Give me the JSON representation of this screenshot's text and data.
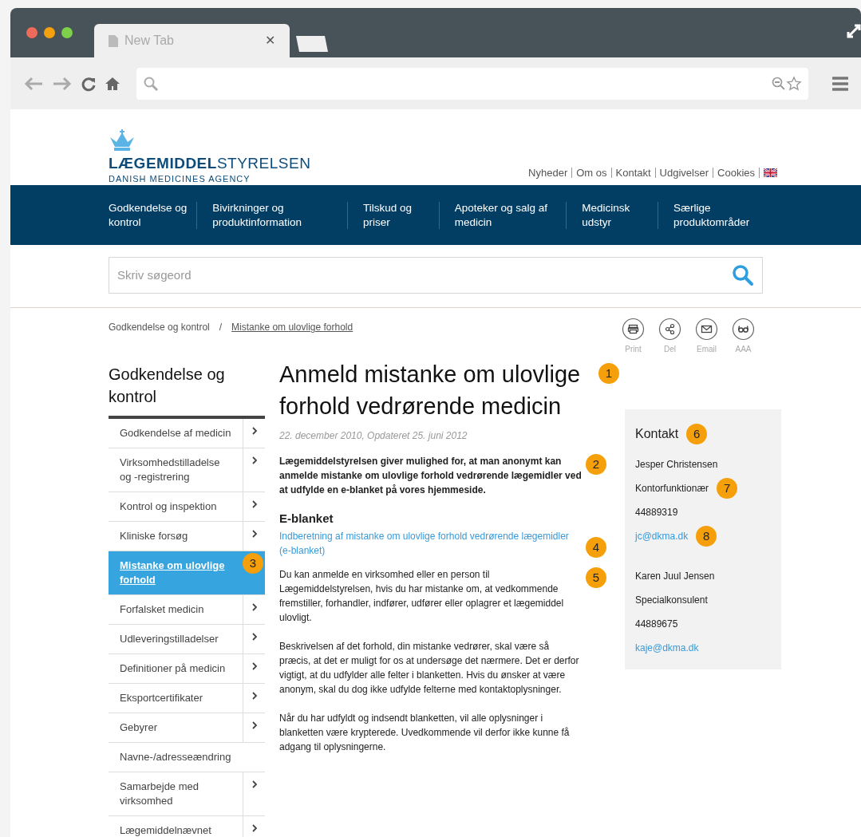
{
  "browser": {
    "tab": {
      "title": "New Tab",
      "close": "✕"
    }
  },
  "site": {
    "logo": {
      "name": "LÆGEMIDDEL",
      "name2": "STYRELSEN",
      "subtitle": "DANISH MEDICINES AGENCY"
    },
    "top_links": [
      "Nyheder",
      "Om os",
      "Kontakt",
      "Udgivelser",
      "Cookies"
    ],
    "nav": [
      "Godkendelse og kontrol",
      "Bivirkninger og produktinformation",
      "Tilskud og priser",
      "Apoteker og salg af medicin",
      "Medicinsk udstyr",
      "Særlige produktområder"
    ],
    "search": {
      "placeholder": "Skriv søgeord"
    },
    "breadcrumb": [
      {
        "label": "Godkendelse og kontrol",
        "current": false
      },
      {
        "label": "Mistanke om ulovlige forhold",
        "current": true
      }
    ],
    "separator": "/",
    "tools": [
      {
        "kind": "print",
        "label": "Print"
      },
      {
        "kind": "share",
        "label": "Del"
      },
      {
        "kind": "email",
        "label": "Email"
      },
      {
        "kind": "glasses",
        "label": "AAA"
      }
    ]
  },
  "sidebar": {
    "title": "Godkendelse og kontrol",
    "items": [
      {
        "label": "Godkendelse af medicin",
        "selected": false,
        "expandable": true
      },
      {
        "label": "Virksomhedstilladelse og -registrering",
        "selected": false,
        "expandable": true
      },
      {
        "label": "Kontrol og inspektion",
        "selected": false,
        "expandable": true
      },
      {
        "label": "Kliniske forsøg",
        "selected": false,
        "expandable": true
      },
      {
        "label": "Mistanke om ulovlige forhold",
        "selected": true,
        "expandable": false,
        "badge": "3"
      },
      {
        "label": "Forfalsket medicin",
        "selected": false,
        "expandable": true
      },
      {
        "label": "Udleveringstilladelser",
        "selected": false,
        "expandable": true
      },
      {
        "label": "Definitioner på medicin",
        "selected": false,
        "expandable": true
      },
      {
        "label": "Eksportcertifikater",
        "selected": false,
        "expandable": true
      },
      {
        "label": "Gebyrer",
        "selected": false,
        "expandable": true
      },
      {
        "label": "Navne-/adresseændring",
        "selected": false,
        "expandable": false
      },
      {
        "label": "Samarbejde med virksomhed",
        "selected": false,
        "expandable": true
      },
      {
        "label": "Lægemiddelnævnet",
        "selected": false,
        "expandable": true
      }
    ]
  },
  "article": {
    "title": "Anmeld mistanke om ulovlige forhold vedrørende medicin",
    "title_badge": "1",
    "date": "22. december 2010, Opdateret 25. juni 2012",
    "intro": "Lægemiddelstyrelsen giver mulighed for, at man anonymt kan anmelde mistanke om ulovlige forhold vedrørende lægemidler ved at udfylde en e-blanket på vores hjemmeside.",
    "intro_badge": "2",
    "subheading": "E-blanket",
    "link": "Indberetning af mistanke om ulovlige forhold vedrørende lægemidler (e-blanket)",
    "link_badge": "4",
    "paragraphs": [
      "Du kan anmelde en virksomhed eller en person til Lægemiddelstyrelsen, hvis du har mistanke om, at vedkommende fremstiller, forhandler, indfører, udfører eller oplagrer et lægemiddel ulovligt.",
      "Beskrivelsen af det forhold, din mistanke vedrører, skal være så præcis, at det er muligt for os at undersøge det nærmere. Det er derfor vigtigt, at du udfylder alle felter i blanketten. Hvis du ønsker at være anonym, skal du dog ikke udfylde felterne med kontaktoplysninger.",
      "Når du har udfyldt og indsendt blanketten, vil alle oplysninger i blanketten være krypterede. Uvedkommende vil derfor ikke kunne få adgang til oplysningerne."
    ],
    "paragraph_badge": "5"
  },
  "contact": {
    "title": "Kontakt",
    "title_badge": "6",
    "people": [
      {
        "name": "Jesper Christensen",
        "role": "Kontorfunktionær",
        "phone": "44889319",
        "email": "jc@dkma.dk",
        "role_badge": "7",
        "email_badge": "8"
      },
      {
        "name": "Karen Juul Jensen",
        "role": "Specialkonsulent",
        "phone": "44889675",
        "email": "kaje@dkma.dk"
      }
    ]
  }
}
